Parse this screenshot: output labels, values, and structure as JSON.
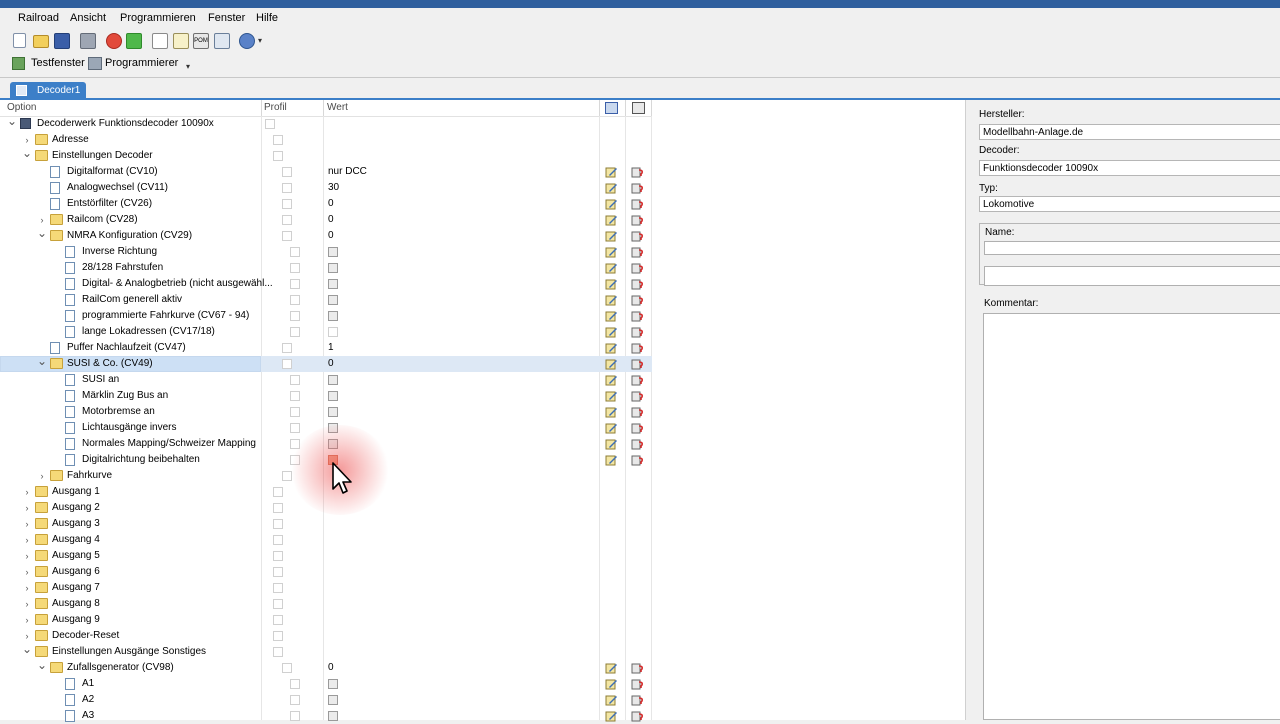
{
  "menu": [
    "Railroad",
    "Ansicht",
    "Programmieren",
    "Fenster",
    "Hilfe"
  ],
  "toolbar_icons": [
    "new-icon",
    "open-icon",
    "save-icon",
    "print-icon",
    "stop-icon",
    "upload-icon",
    "preview-icon",
    "edit-icon",
    "pom-icon",
    "export-icon",
    "globe-icon"
  ],
  "toolbar2": {
    "testfenster": "Testfenster",
    "programmierer": "Programmierer"
  },
  "doc_tab": "Decoder1",
  "grid_header": {
    "option": "Option",
    "profil": "Profil",
    "wert": "Wert"
  },
  "rows": [
    {
      "label": "Decoderwerk Funktionsdecoder 10090x",
      "indent": 0,
      "expander": "down",
      "icon": "device-icon",
      "profil": "cb@265",
      "wert": null,
      "actions": false
    },
    {
      "label": "Adresse",
      "indent": 1,
      "expander": "right",
      "icon": "folder-icon",
      "profil": "cb@273",
      "wert": null,
      "actions": false
    },
    {
      "label": "Einstellungen Decoder",
      "indent": 1,
      "expander": "down",
      "icon": "folder-icon",
      "profil": "cb@273",
      "wert": null,
      "actions": false
    },
    {
      "label": "Digitalformat (CV10)",
      "indent": 2,
      "expander": "",
      "icon": "doc-icon",
      "profil": "cb@282",
      "wert": "nur DCC",
      "actions": true
    },
    {
      "label": "Analogwechsel (CV11)",
      "indent": 2,
      "expander": "",
      "icon": "doc-icon",
      "profil": "cb@282",
      "wert": "30",
      "actions": true
    },
    {
      "label": "Entstörfilter (CV26)",
      "indent": 2,
      "expander": "",
      "icon": "doc-icon",
      "profil": "cb@282",
      "wert": "0",
      "actions": true
    },
    {
      "label": "Railcom (CV28)",
      "indent": 2,
      "expander": "right",
      "icon": "folder-icon",
      "profil": "cb@282",
      "wert": "0",
      "actions": true
    },
    {
      "label": "NMRA Konfiguration (CV29)",
      "indent": 2,
      "expander": "down",
      "icon": "folder-icon",
      "profil": "cb@282",
      "wert": "0",
      "actions": true
    },
    {
      "label": "Inverse Richtung",
      "indent": 3,
      "expander": "",
      "icon": "doc-icon",
      "profil": "cb@290",
      "wert": "cb",
      "actions": true
    },
    {
      "label": "28/128 Fahrstufen",
      "indent": 3,
      "expander": "",
      "icon": "doc-icon",
      "profil": "cb@290",
      "wert": "cb",
      "actions": true
    },
    {
      "label": "Digital- & Analogbetrieb (nicht ausgewähl...",
      "indent": 3,
      "expander": "",
      "icon": "doc-icon",
      "profil": "cb@290",
      "wert": "cb",
      "actions": true
    },
    {
      "label": "RailCom generell aktiv",
      "indent": 3,
      "expander": "",
      "icon": "doc-icon",
      "profil": "cb@290",
      "wert": "cb",
      "actions": true
    },
    {
      "label": "programmierte Fahrkurve (CV67 - 94)",
      "indent": 3,
      "expander": "",
      "icon": "doc-icon",
      "profil": "cb@290",
      "wert": "cb",
      "actions": true
    },
    {
      "label": "lange Lokadressen (CV17/18)",
      "indent": 3,
      "expander": "",
      "icon": "doc-icon",
      "profil": "cb@290",
      "wert": "cblight",
      "actions": true
    },
    {
      "label": "Puffer Nachlaufzeit (CV47)",
      "indent": 2,
      "expander": "",
      "icon": "doc-icon",
      "profil": "cb@282",
      "wert": "1",
      "actions": true
    },
    {
      "label": "SUSI & Co. (CV49)",
      "indent": 2,
      "expander": "down",
      "icon": "folder-icon",
      "profil": "cb@282",
      "wert": "0",
      "actions": true,
      "selected": true
    },
    {
      "label": "SUSI an",
      "indent": 3,
      "expander": "",
      "icon": "doc-icon",
      "profil": "cb@290",
      "wert": "cb",
      "actions": true
    },
    {
      "label": "Märklin Zug Bus an",
      "indent": 3,
      "expander": "",
      "icon": "doc-icon",
      "profil": "cb@290",
      "wert": "cb",
      "actions": true
    },
    {
      "label": "Motorbremse an",
      "indent": 3,
      "expander": "",
      "icon": "doc-icon",
      "profil": "cb@290",
      "wert": "cb",
      "actions": true
    },
    {
      "label": "Lichtausgänge invers",
      "indent": 3,
      "expander": "",
      "icon": "doc-icon",
      "profil": "cb@290",
      "wert": "cb",
      "actions": true
    },
    {
      "label": "Normales Mapping/Schweizer Mapping",
      "indent": 3,
      "expander": "",
      "icon": "doc-icon",
      "profil": "cb@290",
      "wert": "cb",
      "actions": true
    },
    {
      "label": "Digitalrichtung beibehalten",
      "indent": 3,
      "expander": "",
      "icon": "doc-icon",
      "profil": "cb@290",
      "wert": "cbhi",
      "actions": true
    },
    {
      "label": "Fahrkurve",
      "indent": 2,
      "expander": "right",
      "icon": "folder-icon",
      "profil": "cb@282",
      "wert": null,
      "actions": false
    },
    {
      "label": "Ausgang 1",
      "indent": 1,
      "expander": "right",
      "icon": "folder-icon",
      "profil": "cb@273",
      "wert": null,
      "actions": false
    },
    {
      "label": "Ausgang 2",
      "indent": 1,
      "expander": "right",
      "icon": "folder-icon",
      "profil": "cb@273",
      "wert": null,
      "actions": false
    },
    {
      "label": "Ausgang 3",
      "indent": 1,
      "expander": "right",
      "icon": "folder-icon",
      "profil": "cb@273",
      "wert": null,
      "actions": false
    },
    {
      "label": "Ausgang 4",
      "indent": 1,
      "expander": "right",
      "icon": "folder-icon",
      "profil": "cb@273",
      "wert": null,
      "actions": false
    },
    {
      "label": "Ausgang 5",
      "indent": 1,
      "expander": "right",
      "icon": "folder-icon",
      "profil": "cb@273",
      "wert": null,
      "actions": false
    },
    {
      "label": "Ausgang 6",
      "indent": 1,
      "expander": "right",
      "icon": "folder-icon",
      "profil": "cb@273",
      "wert": null,
      "actions": false
    },
    {
      "label": "Ausgang 7",
      "indent": 1,
      "expander": "right",
      "icon": "folder-icon",
      "profil": "cb@273",
      "wert": null,
      "actions": false
    },
    {
      "label": "Ausgang 8",
      "indent": 1,
      "expander": "right",
      "icon": "folder-icon",
      "profil": "cb@273",
      "wert": null,
      "actions": false
    },
    {
      "label": "Ausgang 9",
      "indent": 1,
      "expander": "right",
      "icon": "folder-icon",
      "profil": "cb@273",
      "wert": null,
      "actions": false
    },
    {
      "label": "Decoder-Reset",
      "indent": 1,
      "expander": "right",
      "icon": "folder-icon",
      "profil": "cb@273",
      "wert": null,
      "actions": false
    },
    {
      "label": "Einstellungen Ausgänge Sonstiges",
      "indent": 1,
      "expander": "down",
      "icon": "folder-icon",
      "profil": "cb@273",
      "wert": null,
      "actions": false
    },
    {
      "label": "Zufallsgenerator (CV98)",
      "indent": 2,
      "expander": "down",
      "icon": "folder-icon",
      "profil": "cb@282",
      "wert": "0",
      "actions": true
    },
    {
      "label": "A1",
      "indent": 3,
      "expander": "",
      "icon": "doc-icon",
      "profil": "cb@290",
      "wert": "cb",
      "actions": true
    },
    {
      "label": "A2",
      "indent": 3,
      "expander": "",
      "icon": "doc-icon",
      "profil": "cb@290",
      "wert": "cb",
      "actions": true
    },
    {
      "label": "A3",
      "indent": 3,
      "expander": "",
      "icon": "doc-icon",
      "profil": "cb@290",
      "wert": "cb",
      "actions": true
    }
  ],
  "right_panel": {
    "hersteller_label": "Hersteller:",
    "hersteller_value": "Modellbahn-Anlage.de",
    "decoder_label": "Decoder:",
    "decoder_value": "Funktionsdecoder 10090x",
    "typ_label": "Typ:",
    "typ_value": "Lokomotive",
    "name_label": "Name:",
    "name_value": "",
    "kommentar_label": "Kommentar:",
    "kommentar_value": ""
  },
  "colors": {
    "titlebar": "#2f5f9e",
    "accent": "#3c7fc8",
    "selection": "#cde0f5",
    "highlight": "#f0a68c"
  }
}
